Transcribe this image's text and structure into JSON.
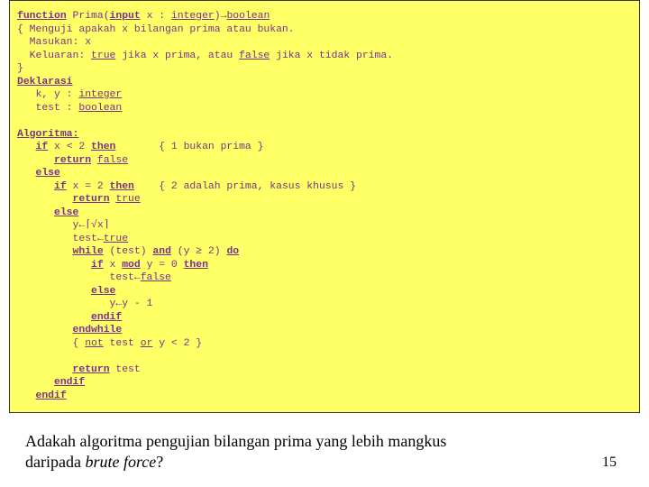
{
  "code": {
    "l1a": "function",
    "l1b": " Prima(",
    "l1c": "input",
    "l1d": " x : ",
    "l1e": "integer",
    "l1f": ")→",
    "l1g": "boolean",
    "l2": "{ Menguji apakah x bilangan prima atau bukan.",
    "l3": "  Masukan: x",
    "l4a": "  Keluaran: ",
    "l4b": "true",
    "l4c": " jika x prima, atau ",
    "l4d": "false",
    "l4e": " jika x tidak prima.",
    "l5": "}",
    "l6": "Deklarasi",
    "l7a": "   k, y : ",
    "l7b": "integer",
    "l8a": "   test : ",
    "l8b": "boolean",
    "blank1": "",
    "l9": "Algoritma:",
    "l10a": "   ",
    "l10b": "if",
    "l10c": " x < 2 ",
    "l10d": "then",
    "l10e": "       { 1 bukan prima }",
    "l11a": "      ",
    "l11b": "return",
    "l11c": " ",
    "l11d": "false",
    "l12a": "   ",
    "l12b": "else",
    "l13a": "      ",
    "l13b": "if",
    "l13c": " x = 2 ",
    "l13d": "then",
    "l13e": "    { 2 adalah prima, kasus khusus }",
    "l14a": "         ",
    "l14b": "return",
    "l14c": " ",
    "l14d": "true",
    "l15a": "      ",
    "l15b": "else",
    "l16": "         y←⌈√x⌉",
    "l17a": "         test←",
    "l17b": "true",
    "l18a": "         ",
    "l18b": "while",
    "l18c": " (test) ",
    "l18d": "and",
    "l18e": " (y ≥ 2) ",
    "l18f": "do",
    "l19a": "            ",
    "l19b": "if",
    "l19c": " x ",
    "l19d": "mod",
    "l19e": " y = 0 ",
    "l19f": "then",
    "l20a": "               test←",
    "l20b": "false",
    "l21a": "            ",
    "l21b": "else",
    "l22": "               y←y - 1",
    "l23a": "            ",
    "l23b": "endif",
    "l24a": "         ",
    "l24b": "endwhile",
    "l25a": "         { ",
    "l25b": "not",
    "l25c": " test ",
    "l25d": "or",
    "l25e": " y < 2 }",
    "blank2": "",
    "l26a": "         ",
    "l26b": "return",
    "l26c": " test",
    "l27a": "      ",
    "l27b": "endif",
    "l28a": "   ",
    "l28b": "endif"
  },
  "caption": {
    "part1": "Adakah algoritma pengujian bilangan prima yang lebih mangkus",
    "part2a": " daripada ",
    "part2b": "brute force",
    "part2c": "?"
  },
  "page": "15"
}
